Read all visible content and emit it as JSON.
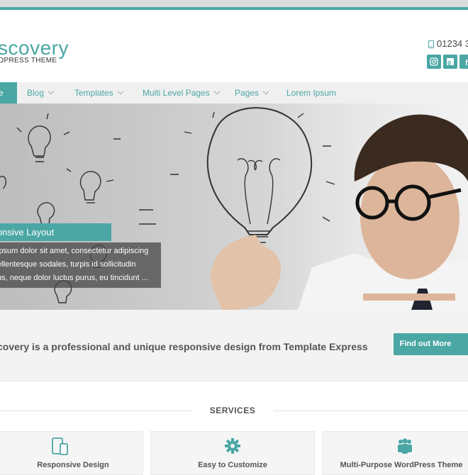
{
  "header": {
    "logo_main": "scovery",
    "logo_sub": "DPRESS THEME",
    "phone": "01234 3",
    "social_icons": [
      "instagram-icon",
      "google-plus-icon",
      "facebook-icon"
    ]
  },
  "nav": {
    "active_label": "e",
    "items": [
      {
        "label": "Blog",
        "has_dropdown": true
      },
      {
        "label": "Templates",
        "has_dropdown": true
      },
      {
        "label": "Multi Level Pages",
        "has_dropdown": true
      },
      {
        "label": "Pages",
        "has_dropdown": true
      },
      {
        "label": "Lorem Ipsum",
        "has_dropdown": false
      }
    ]
  },
  "hero": {
    "caption_title": "onsive Layout",
    "caption_lines": [
      "ipsum dolor sit amet, consectetur adipiscing",
      "ellentesque sodales, turpis id sollicitudin",
      "us, neque dolor luctus purus, eu tincidunt ..."
    ]
  },
  "cta": {
    "text": "covery is a professional and unique responsive design from Template Express",
    "button_label": "Find out More"
  },
  "services": {
    "title": "SERVICES",
    "cards": [
      {
        "title": "Responsive Design",
        "icon": "tablet-mobile-icon"
      },
      {
        "title": "Easy to Customize",
        "icon": "gear-icon"
      },
      {
        "title": "Multi-Purpose WordPress Theme",
        "icon": "users-icon"
      }
    ]
  },
  "colors": {
    "accent": "#4aa7a4",
    "nav_background": "#f0f0f0",
    "cta_background": "#f3f3f3"
  }
}
